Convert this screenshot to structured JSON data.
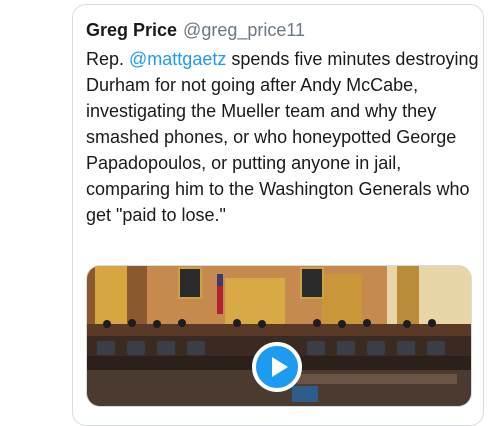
{
  "tweet": {
    "display_name": "Greg Price",
    "handle": "@greg_price11",
    "text_prefix": "Rep. ",
    "mention": "@mattgaetz",
    "text_body": " spends five minutes destroying Durham for not going after Andy McCabe, investigating the Mueller team and why they smashed phones, or who honeypotted George Papadopoulos, or putting anyone in jail, comparing him to the Washington Generals who get \"paid to lose.\""
  },
  "media": {
    "type": "video",
    "play_icon": "play-icon",
    "description_colors": {
      "wall": "#c78a4e",
      "curtain": "#d6a640",
      "dais": "#3a2a22",
      "accent": "#1d9bf0"
    }
  }
}
